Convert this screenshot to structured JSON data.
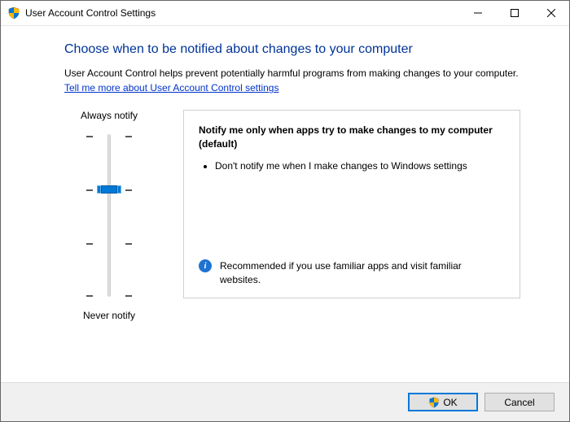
{
  "window": {
    "title": "User Account Control Settings"
  },
  "main": {
    "heading": "Choose when to be notified about changes to your computer",
    "description": "User Account Control helps prevent potentially harmful programs from making changes to your computer.",
    "link_text": "Tell me more about User Account Control settings"
  },
  "slider": {
    "top_label": "Always notify",
    "bottom_label": "Never notify",
    "levels": 4,
    "current_level": 2
  },
  "panel": {
    "title": "Notify me only when apps try to make changes to my computer (default)",
    "bullet": "Don't notify me when I make changes to Windows settings",
    "footer": "Recommended if you use familiar apps and visit familiar websites."
  },
  "buttons": {
    "ok": "OK",
    "cancel": "Cancel"
  }
}
